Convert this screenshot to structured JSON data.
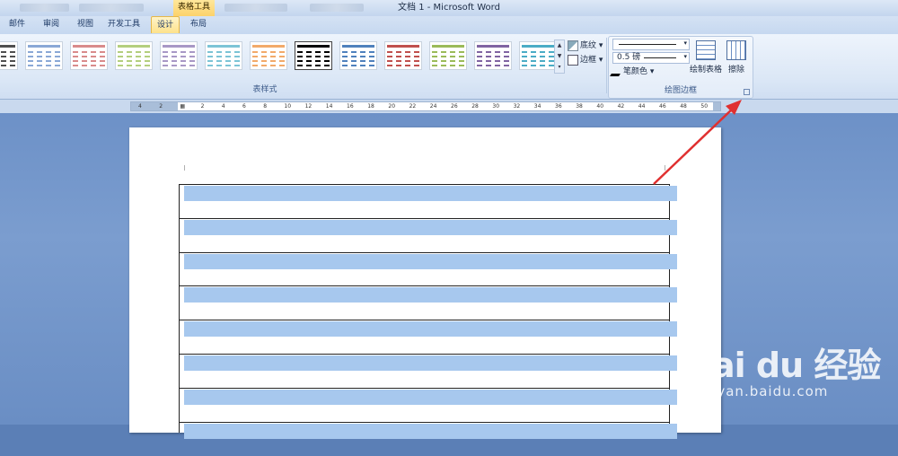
{
  "titlebar": {
    "context_tab": "表格工具",
    "app_title": "文档 1 - Microsoft Word"
  },
  "tabs": [
    {
      "label": "邮件",
      "active": false
    },
    {
      "label": "审阅",
      "active": false
    },
    {
      "label": "视图",
      "active": false
    },
    {
      "label": "开发工具",
      "active": false
    },
    {
      "label": "设计",
      "active": true
    },
    {
      "label": "布局",
      "active": false
    }
  ],
  "ribbon": {
    "styles_group_label": "表样式",
    "shading_label": "底纹",
    "borders_label": "边框",
    "borders_group_label": "绘图边框",
    "line_weight": "0.5 磅",
    "pen_color_label": "笔颜色",
    "draw_table_label": "绘制表格",
    "eraser_label": "擦除",
    "table_style_colors": [
      "#4f4f4f",
      "#8aa8d6",
      "#d98b8b",
      "#b4cf7e",
      "#a898c6",
      "#7cc4d6",
      "#f2aa6a",
      "#000000",
      "#4f81bd",
      "#c0504d",
      "#9bbb59",
      "#8064a2",
      "#4bacc6"
    ]
  },
  "ruler": {
    "ticks": [
      "4",
      "2",
      "",
      "2",
      "4",
      "6",
      "8",
      "10",
      "12",
      "14",
      "16",
      "18",
      "20",
      "22",
      "24",
      "26",
      "28",
      "30",
      "32",
      "34",
      "36",
      "38",
      "40",
      "42",
      "44",
      "46",
      "48",
      "50"
    ]
  },
  "document": {
    "row_count": 8,
    "band_color": "#a7c8ee"
  },
  "annotation": {
    "arrow_color": "#e03030"
  },
  "watermark": {
    "logo_text": "Bai du 经验",
    "url": "jingyan.baidu.com"
  }
}
